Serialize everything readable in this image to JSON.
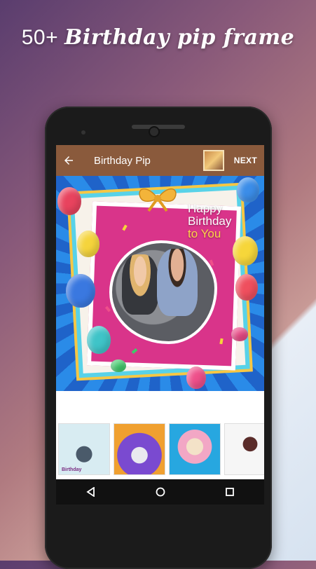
{
  "promo": {
    "number": "50+",
    "text": "Birthday pip frame"
  },
  "app_bar": {
    "back_icon": "arrow-left-icon",
    "title": "Birthday Pip",
    "next_label": "NEXT"
  },
  "canvas": {
    "greeting_line1": "Happy",
    "greeting_line2": "Birthday",
    "greeting_line3": "to You"
  },
  "thumbnails": [
    {
      "name": "frame-balloons-blue",
      "caption": "Birthday"
    },
    {
      "name": "frame-birthday-purple",
      "caption": ""
    },
    {
      "name": "frame-bow-pink",
      "caption": ""
    },
    {
      "name": "frame-party-white",
      "caption": ""
    }
  ],
  "nav": {
    "back": "triangle-back-icon",
    "home": "circle-home-icon",
    "recents": "square-recents-icon"
  }
}
